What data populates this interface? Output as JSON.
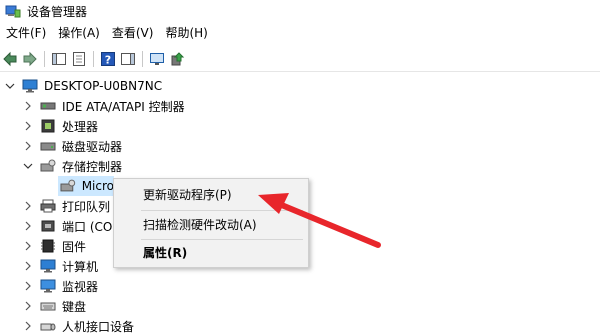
{
  "window": {
    "title": "设备管理器"
  },
  "menu": [
    "文件(F)",
    "操作(A)",
    "查看(V)",
    "帮助(H)"
  ],
  "toolbar": {
    "buttons": [
      "back-icon",
      "forward-icon",
      "show-hide-tree-icon",
      "properties-icon",
      "help-icon",
      "action-pane-icon",
      "monitor-scan-icon",
      "update-driver-icon"
    ]
  },
  "tree": {
    "root": "DESKTOP-U0BN7NC",
    "items": [
      {
        "label": "IDE ATA/ATAPI 控制器",
        "icon": "ide-controller-icon",
        "expanded": false
      },
      {
        "label": "处理器",
        "icon": "processor-icon",
        "expanded": false
      },
      {
        "label": "磁盘驱动器",
        "icon": "disk-drive-icon",
        "expanded": false
      },
      {
        "label": "存储控制器",
        "icon": "storage-controller-icon",
        "expanded": true
      },
      {
        "label": "Micro",
        "icon": "storage-device-icon",
        "child": true,
        "selected": true
      },
      {
        "label": "打印队列",
        "icon": "printer-icon",
        "expanded": false
      },
      {
        "label": "端口 (CO",
        "icon": "port-icon",
        "expanded": false
      },
      {
        "label": "固件",
        "icon": "firmware-icon",
        "expanded": false
      },
      {
        "label": "计算机",
        "icon": "computer-icon",
        "expanded": false
      },
      {
        "label": "监视器",
        "icon": "monitor-icon",
        "expanded": false
      },
      {
        "label": "键盘",
        "icon": "keyboard-icon",
        "expanded": false
      },
      {
        "label": "人机接口设备",
        "icon": "hid-icon",
        "expanded": false
      }
    ]
  },
  "context_menu": {
    "items": [
      "更新驱动程序(P)",
      "扫描检测硬件改动(A)",
      "属性(R)"
    ]
  },
  "colors": {
    "selection": "#cce8ff",
    "arrow": "#e8262b",
    "menu_bg": "#f2f2f2"
  }
}
